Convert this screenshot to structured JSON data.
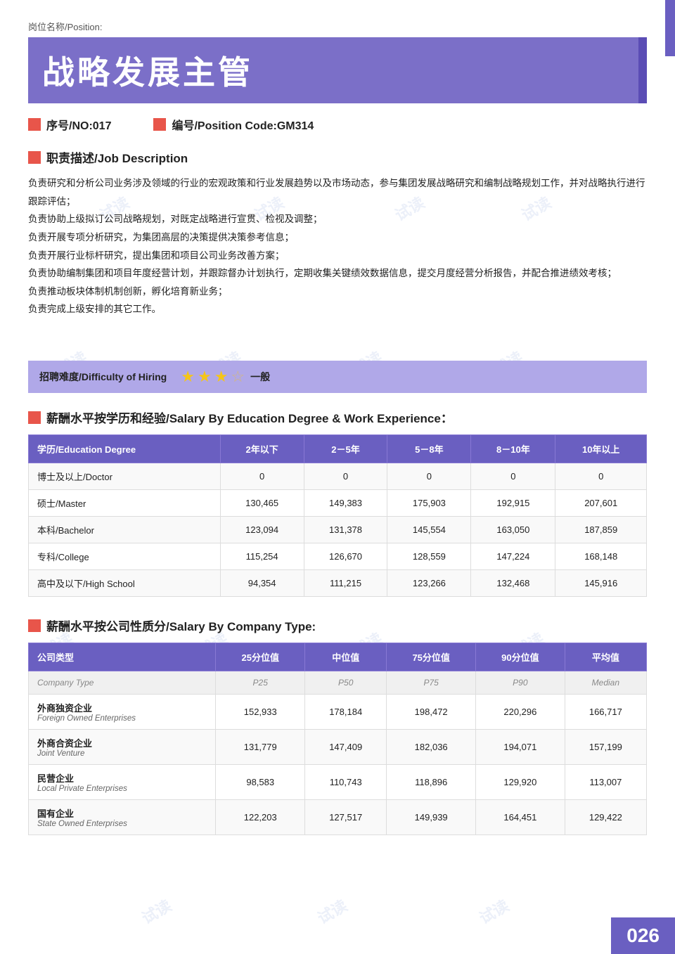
{
  "page": {
    "position_label": "岗位名称/Position:",
    "position_title": "战略发展主管",
    "no_label": "序号/NO:017",
    "code_label": "编号/Position Code:GM314",
    "job_desc_header": "职责描述/Job Description",
    "job_description": [
      "负责研究和分析公司业务涉及领域的行业的宏观政策和行业发展趋势以及市场动态，参与集团发展战略研究和编制战略规划工作，并对战略执行进行跟踪评估；",
      "负责协助上级拟订公司战略规划，对既定战略进行宣贯、检视及调整；",
      "负责开展专项分析研究，为集团高层的决策提供决策参考信息；",
      "负责开展行业标杆研究，提出集团和项目公司业务改善方案；",
      "负责协助编制集团和项目年度经营计划，并跟踪督办计划执行，定期收集关键绩效数据信息，提交月度经营分析报告，并配合推进绩效考核；",
      "负责推动板块体制机制创新，孵化培育新业务；",
      "负责完成上级安排的其它工作。"
    ],
    "difficulty_label": "招聘难度/Difficulty of Hiring",
    "difficulty_stars": 3,
    "difficulty_max": 4,
    "difficulty_text": "一般",
    "salary_edu_header": "薪酬水平按学历和经验/Salary By Education Degree & Work Experience：",
    "salary_edu_columns": [
      "学历/Education Degree",
      "2年以下",
      "2－5年",
      "5－8年",
      "8－10年",
      "10年以上"
    ],
    "salary_edu_rows": [
      {
        "edu": "博士及以上/Doctor",
        "vals": [
          "0",
          "0",
          "0",
          "0",
          "0"
        ]
      },
      {
        "edu": "硕士/Master",
        "vals": [
          "130,465",
          "149,383",
          "175,903",
          "192,915",
          "207,601"
        ]
      },
      {
        "edu": "本科/Bachelor",
        "vals": [
          "123,094",
          "131,378",
          "145,554",
          "163,050",
          "187,859"
        ]
      },
      {
        "edu": "专科/College",
        "vals": [
          "115,254",
          "126,670",
          "128,559",
          "147,224",
          "168,148"
        ]
      },
      {
        "edu": "高中及以下/High School",
        "vals": [
          "94,354",
          "111,215",
          "123,266",
          "132,468",
          "145,916"
        ]
      }
    ],
    "salary_company_header": "薪酬水平按公司性质分/Salary By Company Type:",
    "salary_company_columns": [
      "公司类型",
      "25分位值",
      "中位值",
      "75分位值",
      "90分位值",
      "平均值"
    ],
    "salary_company_subheader": [
      "Company Type",
      "P25",
      "P50",
      "P75",
      "P90",
      "Median"
    ],
    "salary_company_rows": [
      {
        "zh": "外商独资企业",
        "en": "Foreign Owned Enterprises",
        "vals": [
          "152,933",
          "178,184",
          "198,472",
          "220,296",
          "166,717"
        ]
      },
      {
        "zh": "外商合资企业",
        "en": "Joint Venture",
        "vals": [
          "131,779",
          "147,409",
          "182,036",
          "194,071",
          "157,199"
        ]
      },
      {
        "zh": "民营企业",
        "en": "Local Private Enterprises",
        "vals": [
          "98,583",
          "110,743",
          "118,896",
          "129,920",
          "113,007"
        ]
      },
      {
        "zh": "国有企业",
        "en": "State Owned Enterprises",
        "vals": [
          "122,203",
          "127,517",
          "149,939",
          "164,451",
          "129,422"
        ]
      }
    ],
    "page_number": "026",
    "watermarks": [
      "试读",
      "试读",
      "试读",
      "试读",
      "试读",
      "试读",
      "试读",
      "试读",
      "试读",
      "试读",
      "试读",
      "试读"
    ]
  }
}
